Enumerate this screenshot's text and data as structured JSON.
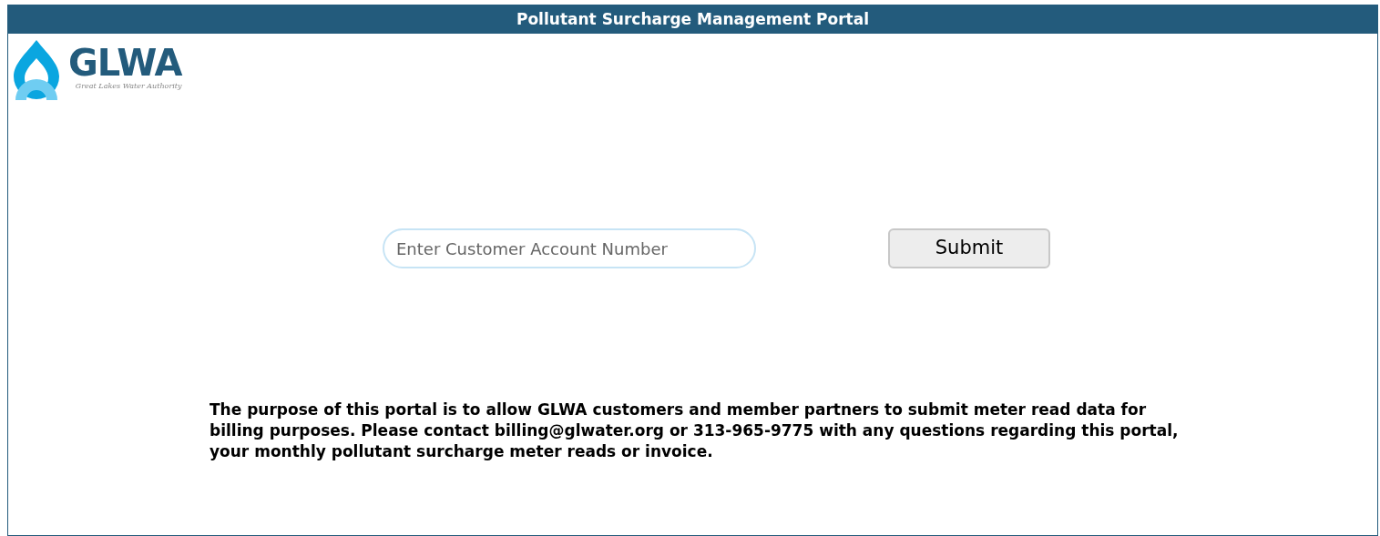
{
  "header": {
    "title": "Pollutant Surcharge Management Portal"
  },
  "logo": {
    "name": "GLWA",
    "tagline": "Great Lakes Water Authority"
  },
  "account_field": {
    "placeholder": "Enter Customer Account Number"
  },
  "submit_button": {
    "label": "Submit"
  },
  "notice": "The purpose of this portal is to allow GLWA customers and member partners to submit meter read data for billing purposes.  Please contact billing@glwater.org or 313-965-9775 with any questions regarding this portal, your monthly pollutant surcharge meter reads or invoice."
}
